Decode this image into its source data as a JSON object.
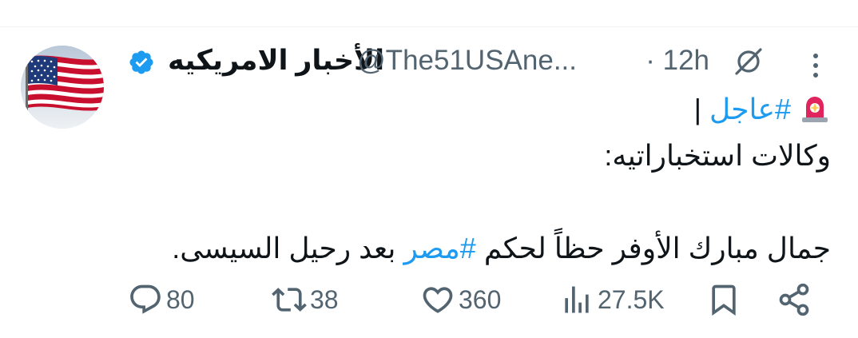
{
  "tweet": {
    "display_name": "الأخبار الامريكيه",
    "handle": "@The51USAne...",
    "time": "· 12h",
    "line1_hashtag": "#عاجل",
    "line1_rest": " |",
    "line2": "وكالات استخباراتيه:",
    "line3_part1": "جمال مبارك الأوفر حظاً لحكم ",
    "line3_hashtag": "#مصر",
    "line3_part2": " بعد رحيل السيسى."
  },
  "actions": {
    "replies": "80",
    "reposts": "38",
    "likes": "360",
    "views": "27.5K"
  },
  "colors": {
    "verified": "#1d9bf0",
    "hashtag": "#1d9bf0",
    "muted": "#536471",
    "siren": "#e0245e"
  }
}
